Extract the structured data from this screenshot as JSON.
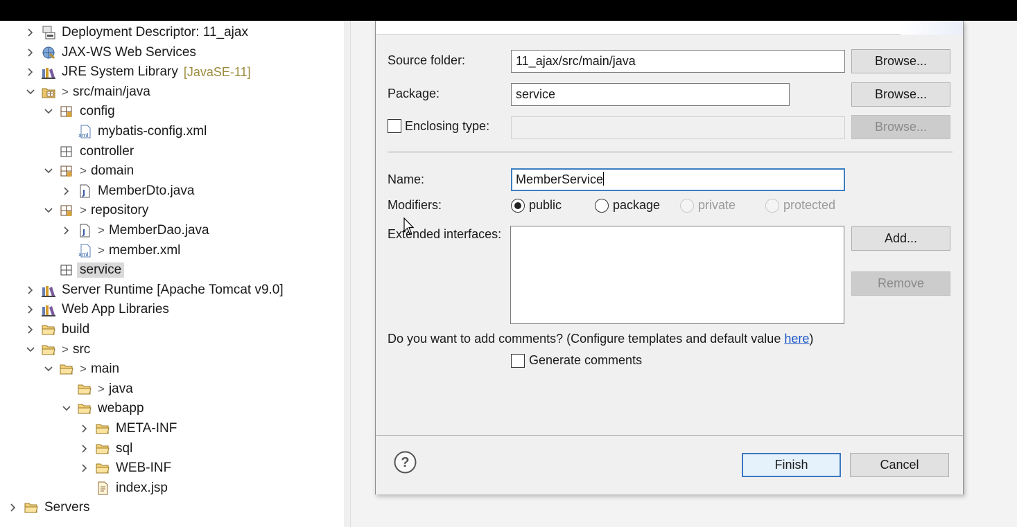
{
  "explorer": {
    "items": [
      {
        "label": "Deployment Descriptor: 11_ajax",
        "icon": "deployment-descriptor-icon",
        "twisty": "collapsed",
        "indent": 0
      },
      {
        "label": "JAX-WS Web Services",
        "icon": "web-services-icon",
        "twisty": "collapsed",
        "indent": 0
      },
      {
        "label": "JRE System Library",
        "decor": "[JavaSE-11]",
        "icon": "library-icon",
        "twisty": "collapsed",
        "indent": 0
      },
      {
        "label": "src/main/java",
        "icon": "source-folder-icon",
        "twisty": "expanded",
        "indent": 0,
        "changed": true
      },
      {
        "label": "config",
        "icon": "package-icon",
        "twisty": "expanded",
        "indent": 1
      },
      {
        "label": "mybatis-config.xml",
        "icon": "xml-file-icon",
        "twisty": "none",
        "indent": 2
      },
      {
        "label": "controller",
        "icon": "empty-package-icon",
        "twisty": "none",
        "indent": 1
      },
      {
        "label": "domain",
        "icon": "package-icon",
        "twisty": "expanded",
        "indent": 1,
        "changed": true
      },
      {
        "label": "MemberDto.java",
        "icon": "java-file-icon",
        "twisty": "collapsed",
        "indent": 2
      },
      {
        "label": "repository",
        "icon": "package-icon",
        "twisty": "expanded",
        "indent": 1,
        "changed": true
      },
      {
        "label": "MemberDao.java",
        "icon": "java-file-icon",
        "twisty": "collapsed",
        "indent": 2,
        "changed": true
      },
      {
        "label": "member.xml",
        "icon": "xml-file-icon",
        "twisty": "none",
        "indent": 2,
        "changed": true
      },
      {
        "label": "service",
        "icon": "empty-package-icon",
        "twisty": "none",
        "indent": 1,
        "selected": true
      },
      {
        "label": "Server Runtime [Apache Tomcat v9.0]",
        "icon": "library-icon",
        "twisty": "collapsed",
        "indent": 0
      },
      {
        "label": "Web App Libraries",
        "icon": "library-icon",
        "twisty": "collapsed",
        "indent": 0
      },
      {
        "label": "build",
        "icon": "folder-icon",
        "twisty": "collapsed",
        "indent": 0
      },
      {
        "label": "src",
        "icon": "folder-icon",
        "twisty": "expanded",
        "indent": 0,
        "changed": true
      },
      {
        "label": "main",
        "icon": "folder-icon",
        "twisty": "expanded",
        "indent": 1,
        "changed": true
      },
      {
        "label": "java",
        "icon": "folder-icon",
        "twisty": "none",
        "indent": 2,
        "changed": true
      },
      {
        "label": "webapp",
        "icon": "folder-icon",
        "twisty": "expanded",
        "indent": 2
      },
      {
        "label": "META-INF",
        "icon": "folder-icon",
        "twisty": "collapsed",
        "indent": 3
      },
      {
        "label": "sql",
        "icon": "folder-icon",
        "twisty": "collapsed",
        "indent": 3
      },
      {
        "label": "WEB-INF",
        "icon": "folder-icon",
        "twisty": "collapsed",
        "indent": 3
      },
      {
        "label": "index.jsp",
        "icon": "jsp-file-icon",
        "twisty": "none",
        "indent": 3
      },
      {
        "label": "Servers",
        "icon": "folder-icon",
        "twisty": "collapsed",
        "indent": -1
      }
    ]
  },
  "dialog": {
    "source_folder": {
      "label": "Source folder:",
      "value": "11_ajax/src/main/java",
      "browse": "Browse..."
    },
    "package": {
      "label": "Package:",
      "value": "service",
      "browse": "Browse..."
    },
    "enclosing": {
      "label": "Enclosing type:",
      "value": "",
      "browse": "Browse..."
    },
    "name": {
      "label": "Name:",
      "value": "MemberService"
    },
    "modifiers": {
      "label": "Modifiers:",
      "options": [
        {
          "label": "public",
          "selected": true,
          "enabled": true
        },
        {
          "label": "package",
          "selected": false,
          "enabled": true
        },
        {
          "label": "private",
          "selected": false,
          "enabled": false
        },
        {
          "label": "protected",
          "selected": false,
          "enabled": false
        }
      ]
    },
    "interfaces": {
      "label": "Extended interfaces:",
      "add": "Add...",
      "remove": "Remove"
    },
    "comments": {
      "question": "Do you want to add comments? (Configure templates and default value ",
      "link": "here",
      "close": ")",
      "checkbox": "Generate comments"
    },
    "finish": "Finish",
    "cancel": "Cancel"
  },
  "colors": {
    "selection": "#d9d9d9",
    "focus_border": "#3c7fc1",
    "link": "#1a55c8",
    "decoration": "#9c8b3c"
  }
}
